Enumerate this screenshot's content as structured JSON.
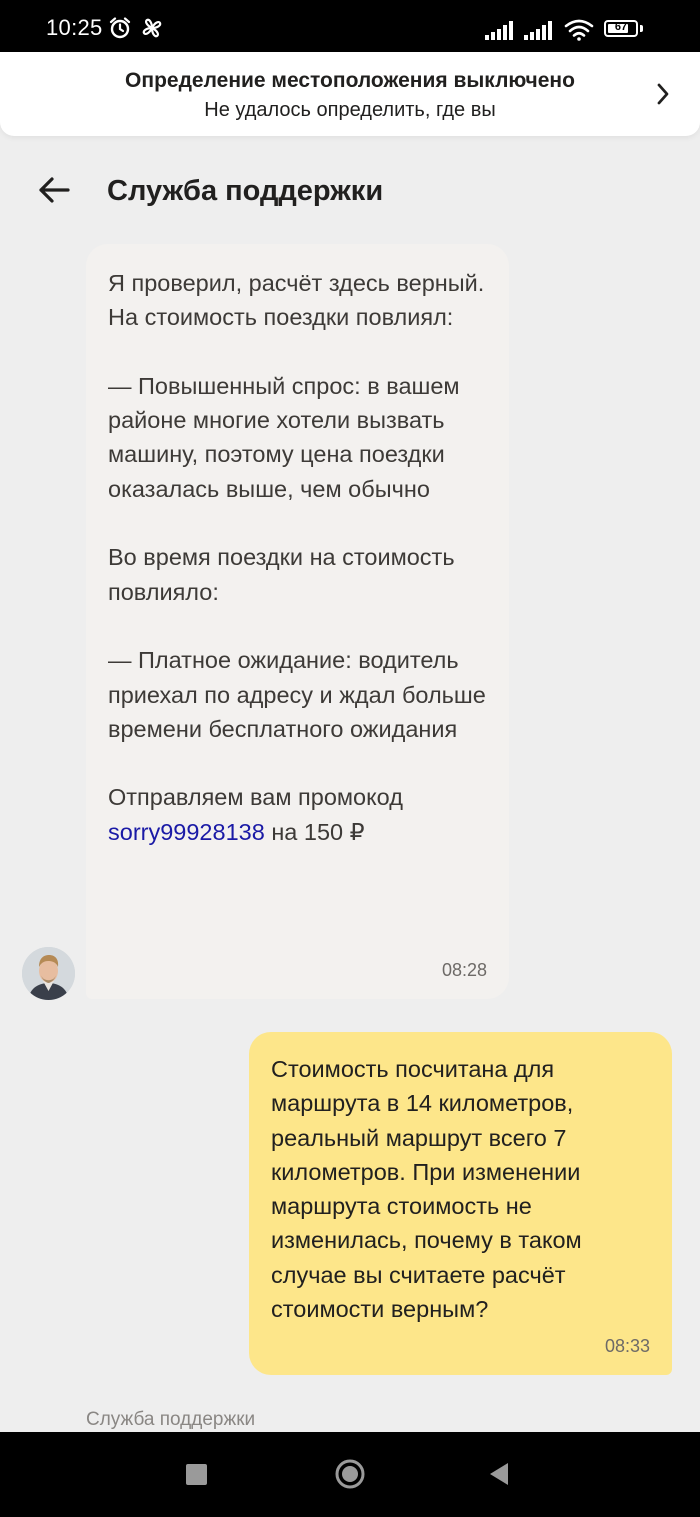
{
  "status_bar": {
    "time": "10:25",
    "battery": "67",
    "icons": [
      "alarm-icon",
      "fan-icon",
      "signal-icon",
      "signal-icon",
      "wifi-icon",
      "battery-icon"
    ]
  },
  "location_banner": {
    "title": "Определение местоположения выключено",
    "subtitle": "Не удалось определить, где вы",
    "icon": "chevron-right-icon"
  },
  "header": {
    "title": "Служба поддержки",
    "back_icon": "arrow-left-icon"
  },
  "messages": [
    {
      "direction": "incoming",
      "paragraphs": [
        "Я проверил, расчёт здесь верный. На стоимость поездки повлиял:",
        "— Повышенный спрос: в вашем районе многие хотели вызвать машину, поэтому цена поездки оказалась выше, чем обычно",
        "Во время поездки на стоимость повлияло:",
        "— Платное ожидание: водитель приехал по адресу и ждал больше времени бесплатного ожидания"
      ],
      "promo_prefix": "Отправляем вам промокод",
      "promo_code": "sorry99928138",
      "promo_suffix": "на 150 ₽",
      "time": "08:28"
    },
    {
      "direction": "outgoing",
      "text": "Стоимость посчитана для маршрута в 14 километров, реальный маршрут всего 7 километров. При изменении маршрута стоимость не изменилась, почему в таком случае вы считаете расчёт стоимости верным?",
      "time": "08:33"
    }
  ],
  "sender_label": "Служба поддержки",
  "colors": {
    "incoming_bubble": "#f3f1ef",
    "outgoing_bubble": "#fde68a",
    "promo_link": "#1a1aa6",
    "background": "#eeeeee"
  }
}
